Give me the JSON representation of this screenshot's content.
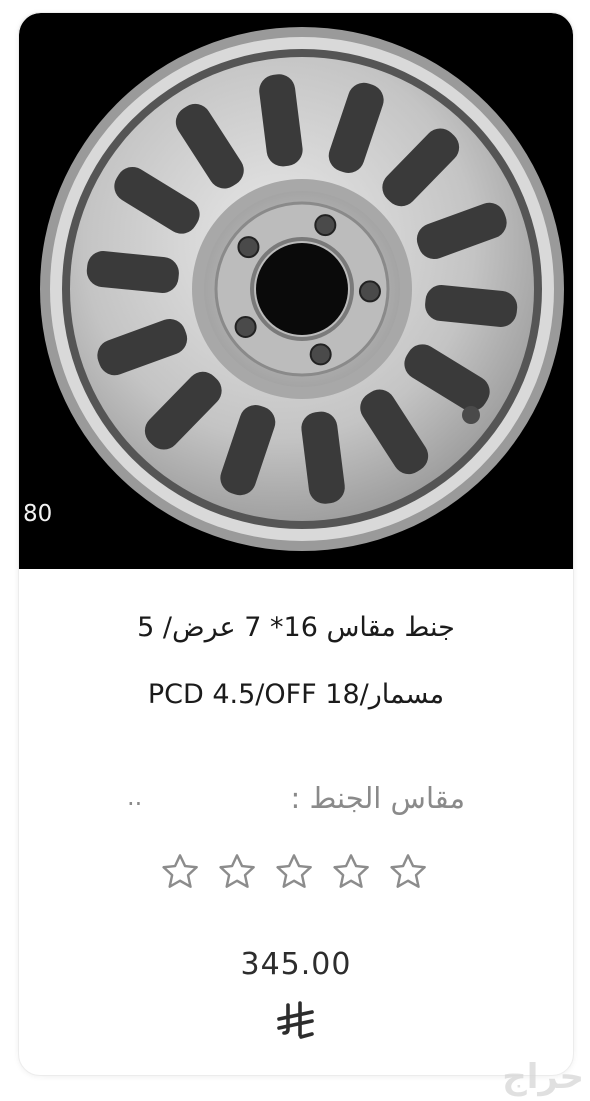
{
  "product": {
    "image_code": "80",
    "title_line1": "جنط مقاس 16* 7 عرض/ 5",
    "title_line2": "مسمار/PCD 4.5/OFF 18",
    "spec_label": "مقاس الجنط :",
    "spec_value": "..",
    "rating": {
      "max": 5,
      "filled": 0
    },
    "price": "345.00",
    "currency_icon": "saudi-riyal-symbol-icon"
  },
  "watermark": {
    "text": "حراج"
  },
  "colors": {
    "photo_background": "#000000",
    "title_text": "#1b1b1b",
    "muted_text": "#8a8a8a",
    "star_outline": "#8c8c8c",
    "price_text": "#2d2d2d"
  }
}
